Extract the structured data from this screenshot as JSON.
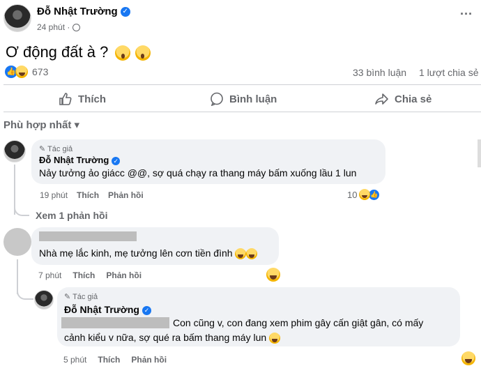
{
  "post": {
    "author": "Đỗ Nhật Trường",
    "time": "24 phút ·",
    "text": "Ơ động đất à ?",
    "reaction_count": "673",
    "comments_count": "33 bình luận",
    "shares_count": "1 lượt chia sẻ",
    "more": "···"
  },
  "actions": {
    "like": "Thích",
    "comment": "Bình luận",
    "share": "Chia sẻ"
  },
  "sort": {
    "label": "Phù hợp nhất",
    "chevron": "▾"
  },
  "comments": [
    {
      "badge": "Tác giả",
      "author": "Đỗ Nhật Trường",
      "text": "Nảy tưởng ảo giácc @@, sợ quá chạy ra thang máy bấm xuống lầu 1 lun",
      "time": "19 phút",
      "like": "Thích",
      "reply": "Phản hồi",
      "reactions": "10",
      "view_replies": "Xem 1 phản hồi"
    },
    {
      "text": "Nhà mẹ lắc kinh, mẹ tưởng lên cơn tiền đình",
      "time": "7 phút",
      "like": "Thích",
      "reply": "Phản hồi"
    },
    {
      "badge": "Tác giả",
      "author": "Đỗ Nhật Trường",
      "text_line1": "Con cũng v, con đang xem phim gây cấn giật gân, có mấy",
      "text_line2": "cảnh kiểu v nữa, sợ qué ra bấm thang máy lun",
      "time": "5 phút",
      "like": "Thích",
      "reply": "Phản hồi"
    }
  ],
  "colors": {
    "accent": "#1877f2",
    "muted": "#65676b",
    "bubble": "#f0f2f5"
  }
}
